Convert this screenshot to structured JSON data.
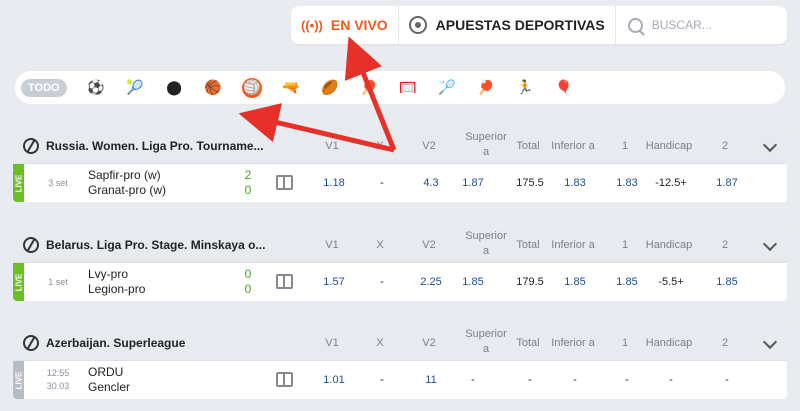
{
  "nav": {
    "live_label": "EN VIVO",
    "sports_label": "APUESTAS DEPORTIVAS",
    "search_placeholder": "BUSCAR..."
  },
  "sports_filter": {
    "all_label": "TODO",
    "icons": [
      "soccer-icon",
      "tennis-icon",
      "hockey-icon",
      "basketball-icon",
      "volleyball-icon",
      "esports-shooter-icon",
      "rugby-icon",
      "table-tennis-icon",
      "handball-icon",
      "badminton-icon",
      "pingpong-icon",
      "runner-icon",
      "hot-air-balloon-icon"
    ],
    "icon_glyphs": [
      "⚽",
      "🎾",
      "⬤",
      "🏀",
      "🏐",
      "🔫",
      "🏉",
      "🏓",
      "🥅",
      "🏸",
      "🏓",
      "🏃",
      "🎈"
    ],
    "active_index": 4
  },
  "columns": [
    "V1",
    "X",
    "V2",
    "Superior a",
    "Total",
    "Inferior a",
    "1",
    "Handicap",
    "2"
  ],
  "events": [
    {
      "league": "Russia. Women. Liga Pro. Tourname...",
      "live_label": "LIVE",
      "period": "3 set",
      "period2": "",
      "team1": "Sapfir-pro (w)",
      "team2": "Granat-pro (w)",
      "score1": "2",
      "score2": "0",
      "odds": [
        "1.18",
        "-",
        "4.3",
        "1.87",
        "175.5",
        "1.83",
        "1.83",
        "-12.5+",
        "1.87"
      ]
    },
    {
      "league": "Belarus. Liga Pro. Stage. Minskaya o...",
      "live_label": "LIVE",
      "period": "1 set",
      "period2": "",
      "team1": "Lvy-pro",
      "team2": "Legion-pro",
      "score1": "0",
      "score2": "0",
      "odds": [
        "1.57",
        "-",
        "2.25",
        "1.85",
        "179.5",
        "1.85",
        "1.85",
        "-5.5+",
        "1.85"
      ]
    },
    {
      "league": "Azerbaijan. Superleague",
      "live_label": "LIVE",
      "period": "12:55",
      "period2": "30.03",
      "team1": "ORDU",
      "team2": "Gencler",
      "score1": "",
      "score2": "",
      "odds": [
        "1.01",
        "-",
        "11",
        "-",
        "-",
        "-",
        "-",
        "-",
        "-"
      ]
    }
  ],
  "colors": {
    "accent": "#f25a1d",
    "live_green": "#6cbd2c",
    "odd_blue": "#1f4f8a",
    "annotation_red": "#e8302b"
  }
}
